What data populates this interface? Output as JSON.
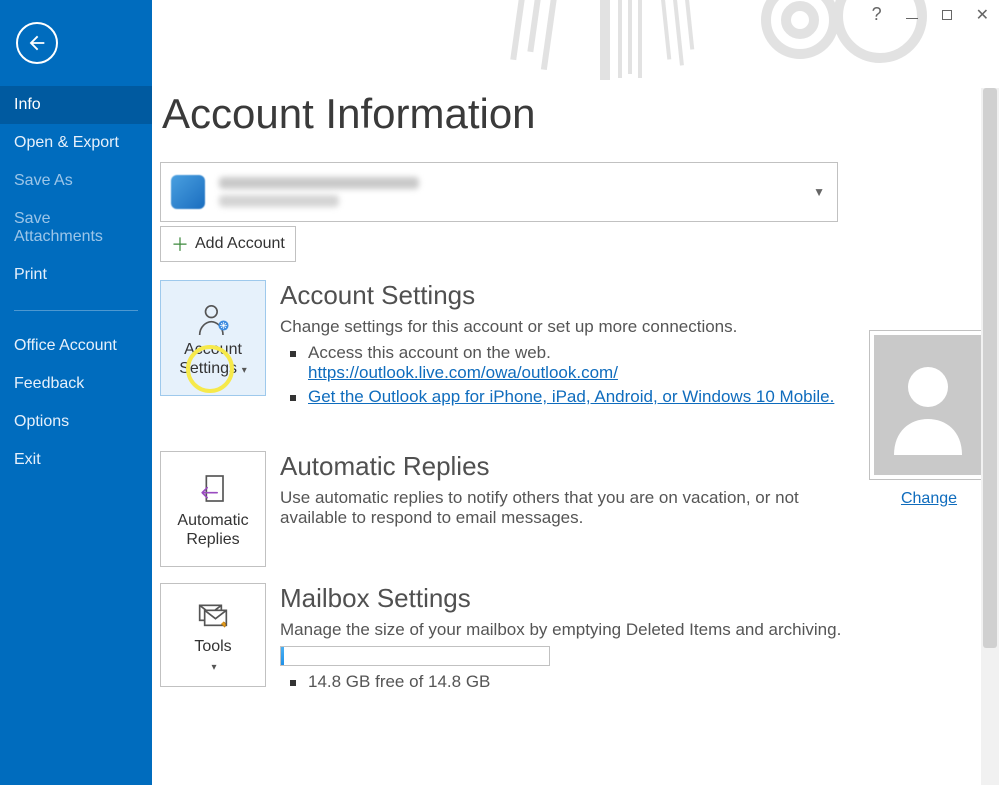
{
  "window": {
    "help_hint": "?"
  },
  "sidebar": {
    "items": [
      {
        "label": "Info",
        "active": true
      },
      {
        "label": "Open & Export"
      },
      {
        "label": "Save As",
        "dim": true
      },
      {
        "label": "Save Attachments",
        "dim": true
      },
      {
        "label": "Print"
      },
      {
        "label": "Office Account"
      },
      {
        "label": "Feedback"
      },
      {
        "label": "Options"
      },
      {
        "label": "Exit"
      }
    ]
  },
  "page": {
    "title": "Account Information",
    "add_account_label": "Add Account"
  },
  "sections": {
    "acct_settings": {
      "tile_label_1": "Account",
      "tile_label_2": "Settings",
      "title": "Account Settings",
      "desc": "Change settings for this account or set up more connections.",
      "bullets": {
        "b1": "Access this account on the web.",
        "b1_link": "https://outlook.live.com/owa/outlook.com/",
        "b2": "Get the Outlook app for iPhone, iPad, Android, or Windows 10 Mobile."
      }
    },
    "auto_reply": {
      "tile_label_1": "Automatic",
      "tile_label_2": "Replies",
      "title": "Automatic Replies",
      "desc": "Use automatic replies to notify others that you are on vacation, or not available to respond to email messages."
    },
    "mailbox": {
      "tile_label": "Tools",
      "title": "Mailbox Settings",
      "desc": "Manage the size of your mailbox by emptying Deleted Items and archiving.",
      "free_text": "14.8 GB free of 14.8 GB"
    }
  },
  "avatar": {
    "change_label": "Change"
  }
}
